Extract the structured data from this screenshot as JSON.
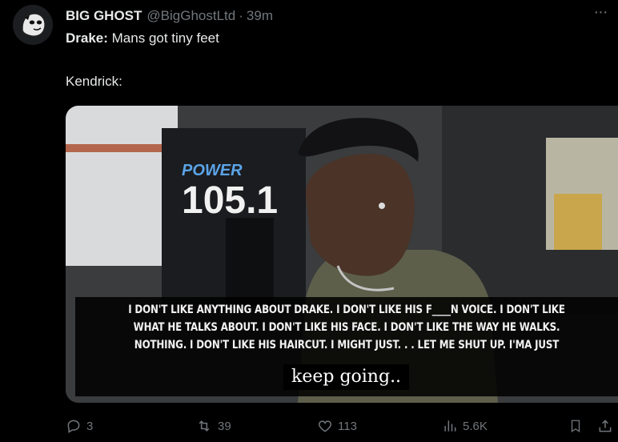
{
  "tweet": {
    "display_name": "BIG GHOST",
    "handle": "@BigGhostLtd",
    "separator": "·",
    "time": "39m",
    "more_glyph": "···",
    "speaker": "Drake:",
    "speaker_line": " Mans got tiny feet",
    "line2": "Kendrick:"
  },
  "media": {
    "sign_text": "POWER",
    "sign_number": "105.1",
    "subtitle_lines": [
      "I DON'T LIKE ANYTHING ABOUT DRAKE. I DON'T LIKE HIS F____N VOICE. I DON'T LIKE",
      "WHAT HE TALKS ABOUT. I DON'T LIKE HIS FACE. I DON'T LIKE THE WAY HE WALKS.",
      "NOTHING. I DON'T LIKE HIS HAIRCUT. I MIGHT JUST. . . LET ME SHUT UP. I'MA JUST"
    ],
    "subtitle_accent": "keep going.."
  },
  "actions": {
    "replies": "3",
    "reposts": "39",
    "likes": "113",
    "views": "5.6K"
  },
  "icons": [
    "ghost-avatar",
    "more-icon",
    "reply-icon",
    "repost-icon",
    "like-icon",
    "views-icon",
    "bookmark-icon",
    "share-icon"
  ],
  "colors": {
    "background": "#000000",
    "text": "#e7e9ea",
    "muted": "#71767b"
  }
}
